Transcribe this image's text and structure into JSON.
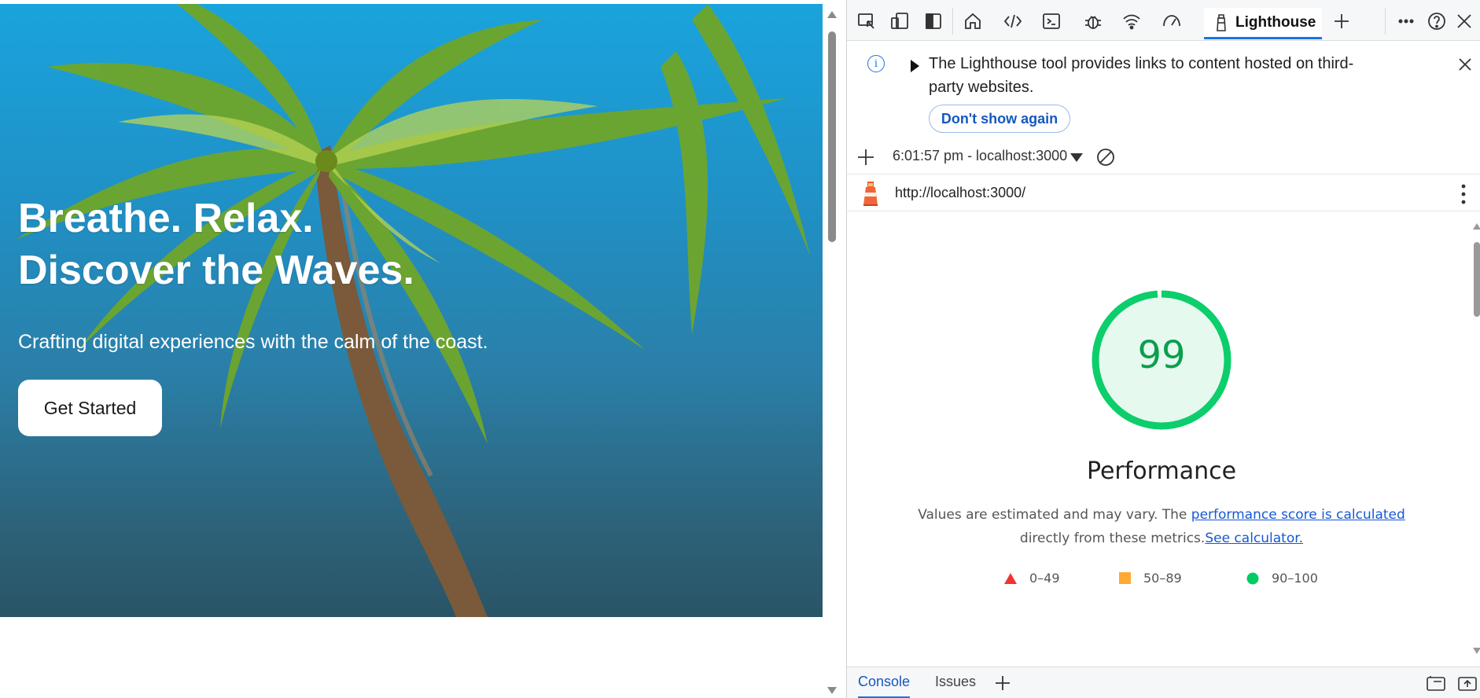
{
  "hero": {
    "title_line1": "Breathe. Relax.",
    "title_line2": "Discover the Waves.",
    "subtitle": "Crafting digital experiences with the calm of the coast.",
    "cta_label": "Get Started"
  },
  "devtools": {
    "toolbar": {
      "active_tab": "Lighthouse",
      "icons": [
        "inspect-icon",
        "device-toolbar-icon",
        "dock-side-icon",
        "welcome-home-icon",
        "elements-icon",
        "console-icon",
        "sources-bug-icon",
        "network-wifi-icon",
        "performance-gauge-icon",
        "lighthouse-icon",
        "add-tab-icon",
        "more-icon",
        "help-icon",
        "close-icon"
      ]
    },
    "infobar": {
      "message": "The Lighthouse tool provides links to content hosted on third-party websites.",
      "dont_show_label": "Don't show again"
    },
    "report_selector": {
      "current_report": "6:01:57 pm - localhost:3000"
    },
    "url": "http://localhost:3000/",
    "report": {
      "score": "99",
      "category": "Performance",
      "score_fraction": 0.99,
      "desc_prefix": "Values are estimated and may vary. The ",
      "desc_link1": "performance score is calculated",
      "desc_middle": "directly from these metrics.",
      "desc_link2": "See calculator.",
      "legend": [
        {
          "label": "0–49",
          "shape": "triangle",
          "color": "#f33333"
        },
        {
          "label": "50–89",
          "shape": "square",
          "color": "#ffaa33"
        },
        {
          "label": "90–100",
          "shape": "circle",
          "color": "#00cc66"
        }
      ]
    },
    "drawer": {
      "tabs": [
        "Console",
        "Issues"
      ],
      "active": "Console"
    }
  },
  "colors": {
    "accent": "#1a73e8",
    "pass": "#0cce6b",
    "pass_bg": "#e6f9ee"
  }
}
